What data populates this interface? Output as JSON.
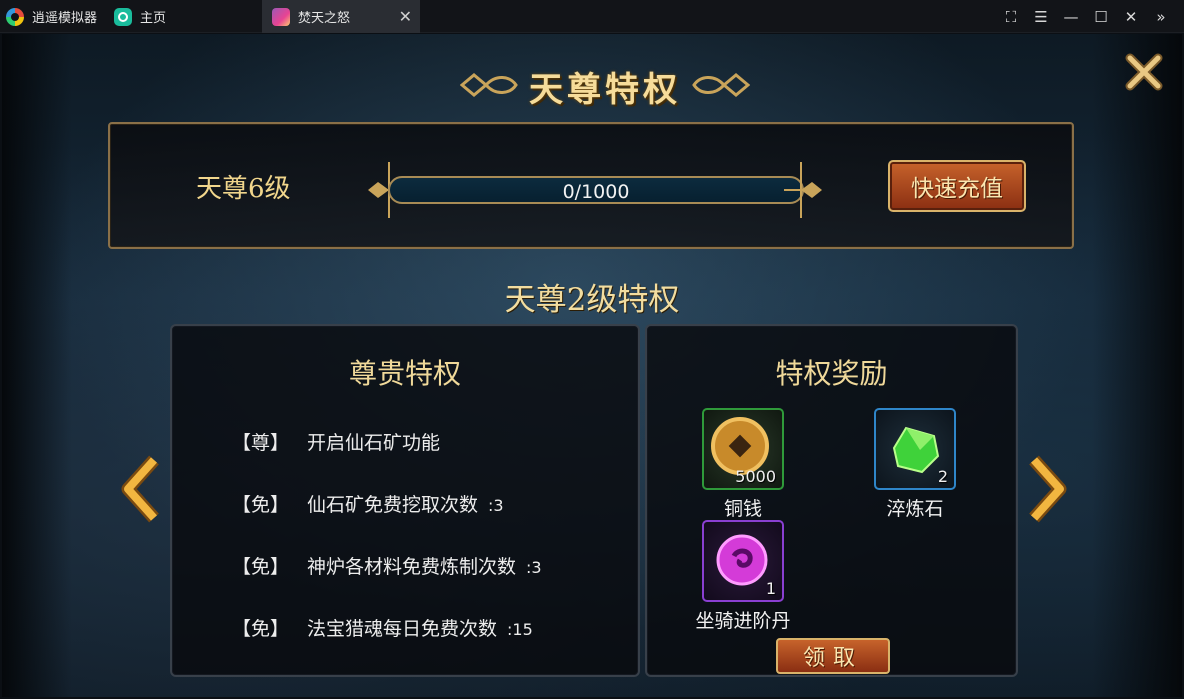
{
  "titlebar": {
    "app_tab": "逍遥模拟器",
    "home_tab": "主页",
    "game_tab": "焚天之怒",
    "close_glyph": "✕",
    "controls": [
      "⛶",
      "☰",
      "—",
      "☐",
      "✕",
      "»"
    ]
  },
  "game": {
    "title": "天尊特权",
    "level": {
      "name": "天尊6级",
      "progress_text": "0/1000",
      "progress_fraction": 0.0,
      "recharge_button": "快速充值"
    },
    "privilege_title": "天尊2级特权",
    "left_panel": {
      "header": "尊贵特权",
      "rows": [
        {
          "tag": "【尊】",
          "text": "开启仙石矿功能",
          "value": ""
        },
        {
          "tag": "【免】",
          "text": "仙石矿免费挖取次数",
          "value": ":3"
        },
        {
          "tag": "【免】",
          "text": "神炉各材料免费炼制次数",
          "value": ":3"
        },
        {
          "tag": "【免】",
          "text": "法宝猎魂每日免费次数",
          "value": ":15"
        }
      ]
    },
    "right_panel": {
      "header": "特权奖励",
      "items": [
        {
          "name": "铜钱",
          "count": "5000",
          "icon": "copper-coin-icon",
          "border": "#2f9a3a"
        },
        {
          "name": "淬炼石",
          "count": "2",
          "icon": "green-gem-icon",
          "border": "#2f86c9"
        },
        {
          "name": "坐骑进阶丹",
          "count": "1",
          "icon": "purple-orb-icon",
          "border": "#8a3fd1"
        }
      ],
      "claim_button": "领取"
    }
  }
}
